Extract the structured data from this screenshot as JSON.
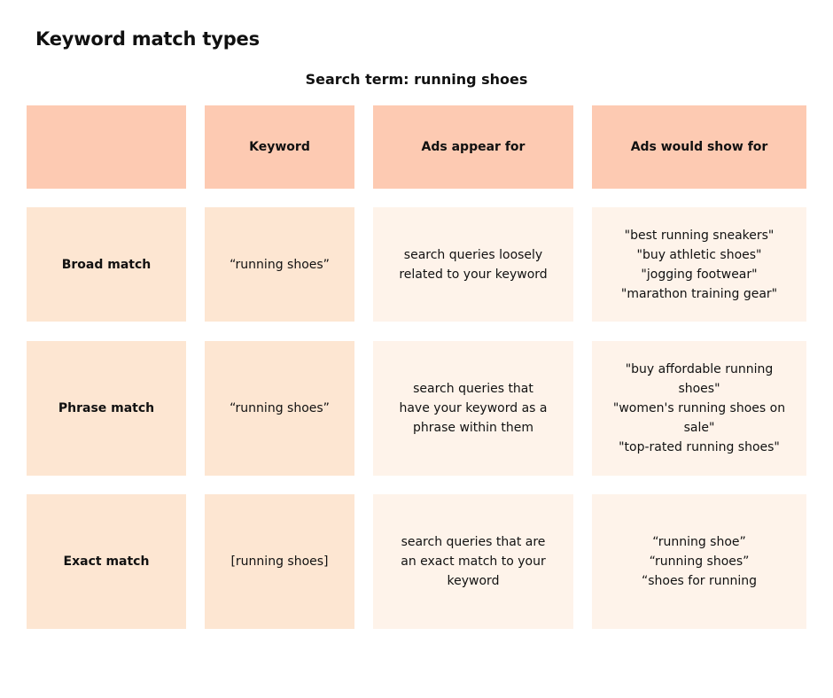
{
  "title": "Keyword match types",
  "subtitle": "Search term: running shoes",
  "colors": {
    "header": "#fdcab2",
    "label_cell": "#fde6d2",
    "text_cell": "#fef3ea"
  },
  "table": {
    "headers": [
      "",
      "Keyword",
      "Ads appear for",
      "Ads would show for"
    ],
    "rows": [
      {
        "match_type": "Broad match",
        "keyword": "“running shoes”",
        "ads_appear_for": "search queries loosely related to your keyword",
        "ads_would_show_for": [
          "\"best running sneakers\"",
          "\"buy athletic shoes\"",
          "\"jogging footwear\"",
          "\"marathon training gear\""
        ]
      },
      {
        "match_type": "Phrase match",
        "keyword": "“running shoes”",
        "ads_appear_for": "search queries that have your keyword as a phrase within them",
        "ads_would_show_for": [
          "\"buy affordable running shoes\"",
          "\"women's running shoes on sale\"",
          "\"top-rated running shoes\""
        ]
      },
      {
        "match_type": "Exact match",
        "keyword": "[running shoes]",
        "ads_appear_for": "search queries that are an exact match to your keyword",
        "ads_would_show_for": [
          "“running shoe”",
          "“running shoes”",
          "“shoes for running"
        ]
      }
    ]
  }
}
